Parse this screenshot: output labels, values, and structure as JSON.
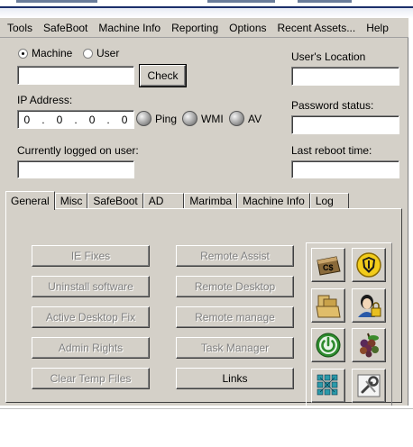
{
  "menu": [
    "Tools",
    "SafeBoot",
    "Machine Info",
    "Reporting",
    "Options",
    "Recent Assets...",
    "Help"
  ],
  "target": {
    "machine_label": "Machine",
    "user_label": "User",
    "selected": "Machine",
    "search_value": "",
    "check_label": "Check"
  },
  "ip": {
    "label": "IP Address:",
    "octets": [
      "0",
      "0",
      "0",
      "0"
    ],
    "ping_label": "Ping",
    "wmi_label": "WMI",
    "av_label": "AV"
  },
  "logged_on": {
    "label": "Currently logged on user:",
    "value": ""
  },
  "right_fields": {
    "users_location_label": "User's Location",
    "users_location_value": "",
    "password_status_label": "Password status:",
    "password_status_value": "",
    "last_reboot_label": "Last reboot time:",
    "last_reboot_value": ""
  },
  "tabs": [
    "General",
    "Misc",
    "SafeBoot",
    "AD",
    "Marimba",
    "Machine Info",
    "Log"
  ],
  "active_tab": "General",
  "buttons_left": [
    {
      "label": "IE Fixes",
      "enabled": false
    },
    {
      "label": "Uninstall software",
      "enabled": false
    },
    {
      "label": "Active Desktop Fix",
      "enabled": false
    },
    {
      "label": "Admin Rights",
      "enabled": false
    },
    {
      "label": "Clear Temp Files",
      "enabled": false
    }
  ],
  "buttons_right": [
    {
      "label": "Remote Assist",
      "enabled": false
    },
    {
      "label": "Remote Desktop",
      "enabled": false
    },
    {
      "label": "Remote manage",
      "enabled": false
    },
    {
      "label": "Task Manager",
      "enabled": false
    },
    {
      "label": "Links",
      "enabled": true
    }
  ],
  "icon_buttons": [
    {
      "icon": "c-drive-share-icon",
      "text": "C$"
    },
    {
      "icon": "antivirus-shield-icon"
    },
    {
      "icon": "folder-files-icon"
    },
    {
      "icon": "user-lock-icon"
    },
    {
      "icon": "power-icon"
    },
    {
      "icon": "grapes-icon"
    },
    {
      "icon": "network-grid-icon"
    },
    {
      "icon": "tools-wrench-icon"
    }
  ],
  "colors": {
    "window_bg": "#d4d0c8",
    "power_green": "#2e8b2e",
    "shield_yellow": "#f2cc1a"
  }
}
